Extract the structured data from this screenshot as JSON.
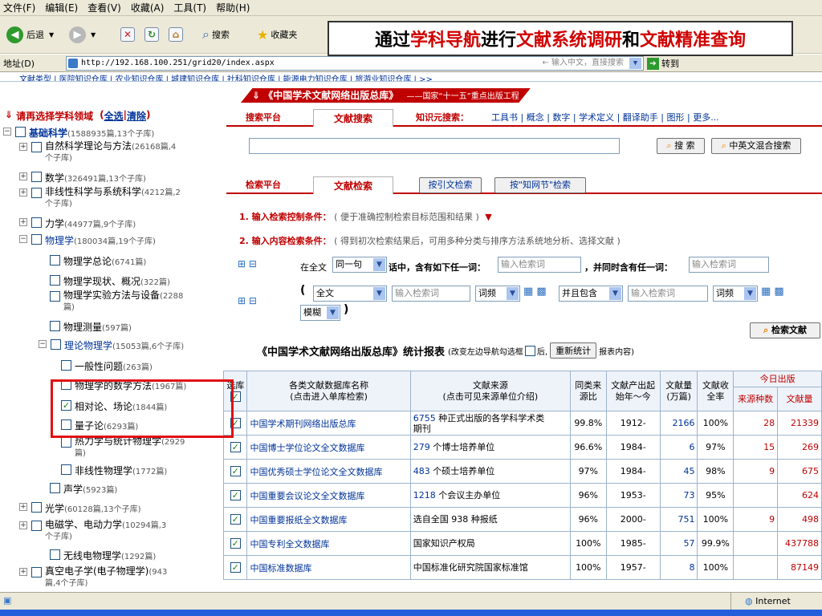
{
  "menu": [
    "文件(F)",
    "编辑(E)",
    "查看(V)",
    "收藏(A)",
    "工具(T)",
    "帮助(H)"
  ],
  "toolbar": {
    "back": "后退",
    "search": "搜索",
    "favorites": "收藏夹"
  },
  "address": {
    "label": "地址(D)",
    "url": "http://192.168.100.251/grid20/index.aspx",
    "right_hint": "← 输入中文，直接搜索",
    "go": "转到"
  },
  "callout": {
    "p1": "通过",
    "p2": "学科导航",
    "p3": "进行",
    "p4": "文献系统调研",
    "p5": "和",
    "p6": "文献精准查询"
  },
  "nav_strip": "文献类型 | 医院知识仓库 | 农业知识仓库 | 城建知识仓库 | 社科知识仓库 | 能源电力知识仓库 | 旅游业知识仓库 | >>",
  "left": {
    "header": "请再选择学科领域",
    "select_all": "全选",
    "clear": "清除",
    "nodes": [
      {
        "pm": "−",
        "label": "基础科学",
        "count": "(1588935篇,13个子库)",
        "checked": false
      },
      {
        "pm": "+",
        "label": "自然科学理论与方法",
        "count": "(26168篇,4",
        "count2": "个子库)",
        "checked": false
      },
      {
        "pm": "+",
        "label": "数学",
        "count": "(326491篇,13个子库)",
        "checked": false
      },
      {
        "pm": "+",
        "label": "非线性科学与系统科学",
        "count": "(4212篇,2",
        "count2": "个子库)",
        "checked": false
      },
      {
        "pm": "+",
        "label": "力学",
        "count": "(44977篇,9个子库)",
        "checked": false
      },
      {
        "pm": "−",
        "label": "物理学",
        "count": "(180034篇,19个子库)",
        "checked": false
      },
      {
        "pm": "",
        "label": "物理学总论",
        "count": "(6741篇)",
        "checked": false
      },
      {
        "pm": "",
        "label": "物理学现状、概况",
        "count": "(322篇)",
        "checked": false
      },
      {
        "pm": "",
        "label": "物理学实验方法与设备",
        "count": "(2288",
        "count2": "篇)",
        "checked": false
      },
      {
        "pm": "",
        "label": "物理测量",
        "count": "(597篇)",
        "checked": false
      },
      {
        "pm": "−",
        "label": "理论物理学",
        "count": "(15053篇,6个子库)",
        "checked": false
      },
      {
        "pm": "",
        "label": "一般性问题",
        "count": "(263篇)",
        "checked": false
      },
      {
        "pm": "",
        "label": "物理学的数学方法",
        "count": "(1967篇)",
        "checked": false
      },
      {
        "pm": "",
        "label": "相对论、场论",
        "count": "(1844篇)",
        "checked": true
      },
      {
        "pm": "",
        "label": "量子论",
        "count": "(6293篇)",
        "checked": false
      },
      {
        "pm": "",
        "label": "热力学与统计物理学",
        "count": "(2929",
        "count2": "篇)",
        "checked": false
      },
      {
        "pm": "",
        "label": "非线性物理学",
        "count": "(1772篇)",
        "checked": false
      },
      {
        "pm": "",
        "label": "声学",
        "count": "(5923篇)",
        "checked": false
      },
      {
        "pm": "+",
        "label": "光学",
        "count": "(60128篇,13个子库)",
        "checked": false
      },
      {
        "pm": "+",
        "label": "电磁学、电动力学",
        "count": "(10294篇,3",
        "count2": "个子库)",
        "checked": false
      },
      {
        "pm": "",
        "label": "无线电物理学",
        "count": "(1292篇)",
        "checked": false
      },
      {
        "pm": "+",
        "label": "真空电子学(电子物理学)",
        "count": "(943",
        "count2": "篇,4个子库)",
        "checked": false
      }
    ]
  },
  "main": {
    "banner": "《中国学术文献网络出版总库》",
    "banner_sub": "——国家“十一五”重点出版工程",
    "tab1": {
      "platform": "搜索平台",
      "active": "文献搜索",
      "knowledge": "知识元搜索：",
      "links": "工具书 | 概念 | 数字 | 学术定义 | 翻译助手 | 图形 | 更多..."
    },
    "search_btn": "搜 索",
    "mixed_btn": "中英文混合搜索",
    "tab2": {
      "platform": "检索平台",
      "active": "文献检索",
      "cite": "按引文检索",
      "node": "按\"知网节\"检索"
    },
    "step1": "1. 输入检索控制条件：",
    "step1_hint": "( 便于准确控制检索目标范围和结果 )",
    "step2": "2. 输入内容检索条件：",
    "step2_hint": "( 得到初次检索结果后，可用多种分类与排序方法系统地分析、选择文献 )",
    "row1": {
      "pre": "在全文",
      "sel": "同一句",
      "mid": "话中，含有如下任一词：",
      "ph": "输入检索词",
      "and": "，并同时含有任一词：",
      "ph2": "输入检索词"
    },
    "row2": {
      "paren": "(",
      "field": "全文",
      "ph": "输入检索词",
      "freq": "词频",
      "rel": "并且包含",
      "ph2": "输入检索词",
      "freq2": "词频",
      "mode": "模糊",
      "close": ")"
    },
    "search_docs": "检索文献",
    "stats_title": "《中国学术文献网络出版总库》统计报表",
    "stats_hint1": "(改变左边导航勾选框",
    "stats_hint2": "后,",
    "recount": "重新统计",
    "stats_hint3": "报表内容)",
    "headers": {
      "sel": "选库",
      "name1": "各类文献数据库名称",
      "name2": "(点击进入单库检索)",
      "src1": "文献来源",
      "src2": "(点击可见来源单位介绍)",
      "ratio1": "同类来",
      "ratio2": "源比",
      "years1": "文献产出起",
      "years2": "始年～今",
      "amount1": "文献量",
      "amount2": "(万篇)",
      "coverage1": "文献收",
      "coverage2": "全率",
      "today": "今日出版",
      "today_src": "来源种数",
      "today_amt": "文献量"
    },
    "rows": [
      {
        "name": "中国学术期刊网络出版总库",
        "src_num": "6755",
        "src": "种正式出版的各学科学术类",
        "src_line2": "期刊",
        "ratio": "99.8%",
        "years": "1912-",
        "amount": "2166",
        "cov": "100%",
        "tsrc": "28",
        "tamt": "21339"
      },
      {
        "name": "中国博士学位论文全文数据库",
        "src_num": "279",
        "src": "个博士培养单位",
        "src_line2": "",
        "ratio": "96.6%",
        "years": "1984-",
        "amount": "6",
        "cov": "97%",
        "tsrc": "15",
        "tamt": "269"
      },
      {
        "name": "中国优秀硕士学位论文全文数据库",
        "src_num": "483",
        "src": "个硕士培养单位",
        "src_line2": "",
        "ratio": "97%",
        "years": "1984-",
        "amount": "45",
        "cov": "98%",
        "tsrc": "9",
        "tamt": "675"
      },
      {
        "name": "中国重要会议论文全文数据库",
        "src_num": "1218",
        "src": "个会议主办单位",
        "src_line2": "",
        "ratio": "96%",
        "years": "1953-",
        "amount": "73",
        "cov": "95%",
        "tsrc": "",
        "tamt": "624"
      },
      {
        "name": "中国重要报纸全文数据库",
        "src_num": "",
        "src": "选自全国 938 种报纸",
        "src_line2": "",
        "ratio": "96%",
        "years": "2000-",
        "amount": "751",
        "cov": "100%",
        "tsrc": "9",
        "tamt": "498"
      },
      {
        "name": "中国专利全文数据库",
        "src_num": "",
        "src": "国家知识产权局",
        "src_line2": "",
        "ratio": "100%",
        "years": "1985-",
        "amount": "57",
        "cov": "99.9%",
        "tsrc": "",
        "tamt": "437788"
      },
      {
        "name": "中国标准数据库",
        "src_num": "",
        "src": "中国标准化研究院国家标准馆",
        "src_line2": "",
        "ratio": "100%",
        "years": "1957-",
        "amount": "8",
        "cov": "100%",
        "tsrc": "",
        "tamt": "87149"
      }
    ]
  },
  "status": {
    "zone": "Internet"
  }
}
